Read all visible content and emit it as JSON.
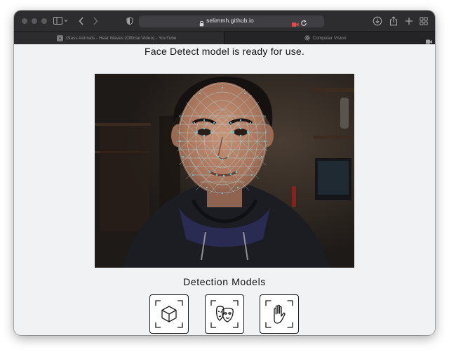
{
  "browser": {
    "url": "selimmh.github.io",
    "tabs": [
      {
        "label": "Glass Animals - Heat Waves (Official Video) - YouTube",
        "active": false
      },
      {
        "label": "Computer Vision",
        "active": true
      }
    ]
  },
  "page": {
    "status_message": "Face Detect model is ready for use.",
    "section_title": "Detection Models",
    "models": [
      {
        "icon": "cube-detect-icon"
      },
      {
        "icon": "face-mask-detect-icon"
      },
      {
        "icon": "hand-detect-icon"
      }
    ]
  },
  "colors": {
    "mesh": "#6fd3e6",
    "chrome": "#2d2d2f",
    "page_bg": "#f1f2f4",
    "record_indicator": "#e5484d"
  }
}
